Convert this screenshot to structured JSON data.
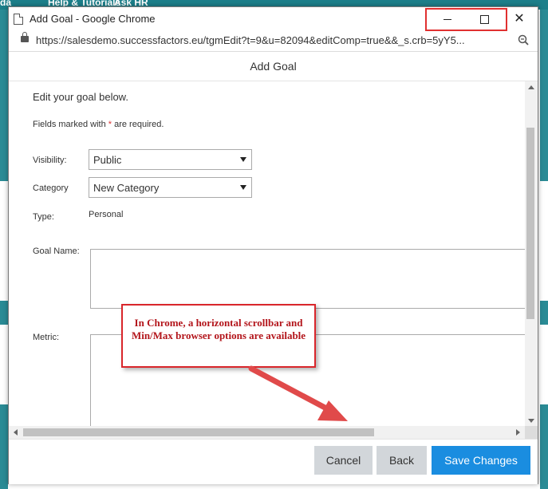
{
  "background": {
    "nav_items": [
      "da",
      "Help & Tutorials",
      "Ask HR"
    ]
  },
  "window": {
    "title": "Add Goal - Google Chrome",
    "url": "https://salesdemo.successfactors.eu/tgmEdit?t=9&u=82094&editComp=true&&_s.crb=5yY5...",
    "minimize_icon": "minimize-icon",
    "maximize_icon": "maximize-icon",
    "close_icon": "close-icon"
  },
  "dialog": {
    "title": "Add Goal",
    "intro": "Edit your goal below.",
    "required_prefix": "Fields marked with ",
    "required_star": "*",
    "required_suffix": " are required.",
    "fields": {
      "visibility_label": "Visibility:",
      "visibility_value": "Public",
      "category_label": "Category",
      "category_value": "New Category",
      "type_label": "Type:",
      "type_value": "Personal",
      "goal_name_label": "Goal Name:",
      "metric_label": "Metric:"
    }
  },
  "buttons": {
    "cancel": "Cancel",
    "back": "Back",
    "save": "Save Changes"
  },
  "annotation": {
    "callout_text": "In Chrome, a horizontal scrollbar and Min/Max browser options are available"
  },
  "colors": {
    "accent": "#1a8de0",
    "annotation_red": "#d9262b",
    "background_teal": "#1c7f8a"
  }
}
